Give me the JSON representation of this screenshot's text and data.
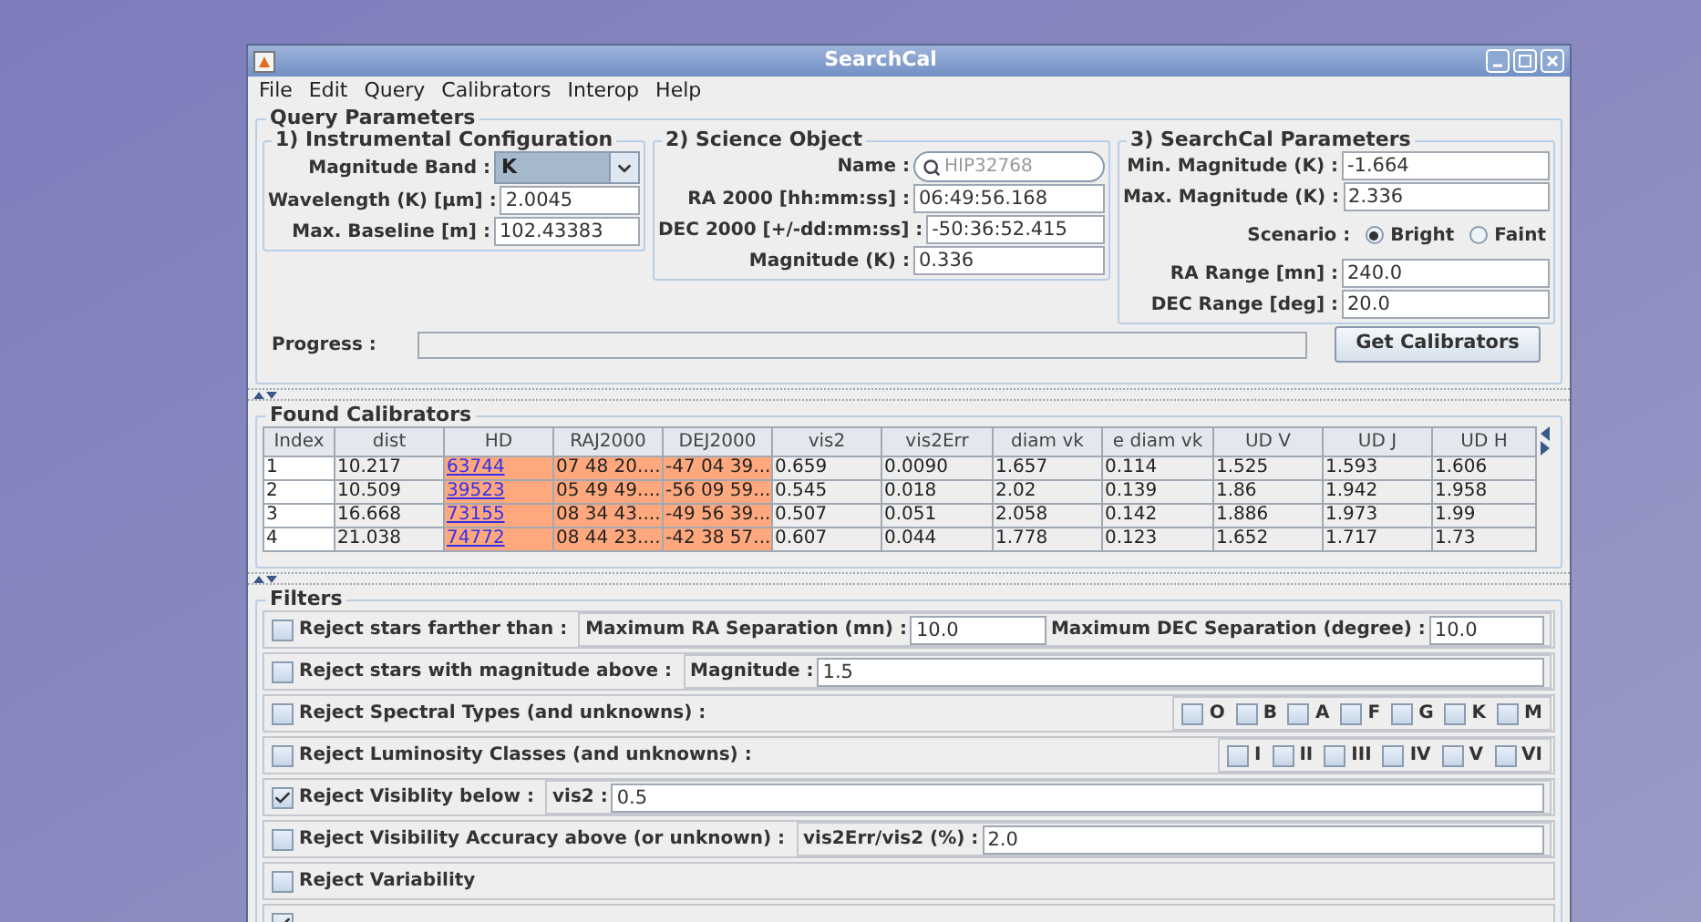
{
  "window": {
    "title": "SearchCal"
  },
  "menu": [
    "File",
    "Edit",
    "Query",
    "Calibrators",
    "Interop",
    "Help"
  ],
  "query_parameters": {
    "title": "Query Parameters",
    "instrumental": {
      "title": "1)  Instrumental Configuration",
      "fields": [
        {
          "kind": "combo",
          "label": "Magnitude Band :",
          "value": "K"
        },
        {
          "kind": "text",
          "label": "Wavelength (K) [µm] :",
          "value": "2.0045"
        },
        {
          "kind": "text",
          "label": "Max. Baseline [m] :",
          "value": "102.43383"
        }
      ]
    },
    "science": {
      "title": "2)  Science Object",
      "fields": [
        {
          "kind": "search",
          "label": "Name :",
          "placeholder": "HIP32768"
        },
        {
          "kind": "text",
          "label": "RA 2000 [hh:mm:ss] :",
          "value": "06:49:56.168"
        },
        {
          "kind": "text",
          "label": "DEC 2000 [+/-dd:mm:ss] :",
          "value": "-50:36:52.415"
        },
        {
          "kind": "text",
          "label": "Magnitude (K) :",
          "value": "0.336"
        }
      ]
    },
    "searchcal": {
      "title": "3)  SearchCal Parameters",
      "fields_top": [
        {
          "label": "Min. Magnitude (K) :",
          "value": "-1.664"
        },
        {
          "label": "Max. Magnitude (K) :",
          "value": "2.336"
        }
      ],
      "scenario": {
        "label": "Scenario :",
        "options": [
          {
            "label": "Bright",
            "selected": true
          },
          {
            "label": "Faint",
            "selected": false
          }
        ]
      },
      "fields_bottom": [
        {
          "label": "RA Range [mn] :",
          "value": "240.0"
        },
        {
          "label": "DEC Range [deg] :",
          "value": "20.0"
        }
      ]
    },
    "progress": {
      "label": "Progress :",
      "level": 0
    },
    "button": "Get Calibrators"
  },
  "found_calibrators": {
    "title": "Found Calibrators",
    "columns": [
      "Index",
      "dist",
      "HD",
      "RAJ2000",
      "DEJ2000",
      "vis2",
      "vis2Err",
      "diam vk",
      "e diam vk",
      "UD V",
      "UD J",
      "UD H"
    ],
    "rows": [
      [
        {
          "text": "1",
          "kind": "index"
        },
        {
          "text": "10.217",
          "kind": "plain"
        },
        {
          "text": "63744",
          "kind": "link"
        },
        {
          "text": "07 48 20....",
          "kind": "highlight"
        },
        {
          "text": "-47 04 39...",
          "kind": "highlight"
        },
        {
          "text": "0.659",
          "kind": "plain"
        },
        {
          "text": "0.0090",
          "kind": "plain"
        },
        {
          "text": "1.657",
          "kind": "plain"
        },
        {
          "text": "0.114",
          "kind": "plain"
        },
        {
          "text": "1.525",
          "kind": "plain"
        },
        {
          "text": "1.593",
          "kind": "plain"
        },
        {
          "text": "1.606",
          "kind": "plain"
        }
      ],
      [
        {
          "text": "2",
          "kind": "index"
        },
        {
          "text": "10.509",
          "kind": "plain"
        },
        {
          "text": "39523",
          "kind": "link"
        },
        {
          "text": "05 49 49....",
          "kind": "highlight"
        },
        {
          "text": "-56 09 59...",
          "kind": "highlight"
        },
        {
          "text": "0.545",
          "kind": "plain"
        },
        {
          "text": "0.018",
          "kind": "plain"
        },
        {
          "text": "2.02",
          "kind": "plain"
        },
        {
          "text": "0.139",
          "kind": "plain"
        },
        {
          "text": "1.86",
          "kind": "plain"
        },
        {
          "text": "1.942",
          "kind": "plain"
        },
        {
          "text": "1.958",
          "kind": "plain"
        }
      ],
      [
        {
          "text": "3",
          "kind": "index"
        },
        {
          "text": "16.668",
          "kind": "plain"
        },
        {
          "text": "73155",
          "kind": "link"
        },
        {
          "text": "08 34 43....",
          "kind": "highlight"
        },
        {
          "text": "-49 56 39...",
          "kind": "highlight"
        },
        {
          "text": "0.507",
          "kind": "plain"
        },
        {
          "text": "0.051",
          "kind": "plain"
        },
        {
          "text": "2.058",
          "kind": "plain"
        },
        {
          "text": "0.142",
          "kind": "plain"
        },
        {
          "text": "1.886",
          "kind": "plain"
        },
        {
          "text": "1.973",
          "kind": "plain"
        },
        {
          "text": "1.99",
          "kind": "plain"
        }
      ],
      [
        {
          "text": "4",
          "kind": "index"
        },
        {
          "text": "21.038",
          "kind": "plain"
        },
        {
          "text": "74772",
          "kind": "link"
        },
        {
          "text": "08 44 23....",
          "kind": "highlight"
        },
        {
          "text": "-42 38 57...",
          "kind": "highlight"
        },
        {
          "text": "0.607",
          "kind": "plain"
        },
        {
          "text": "0.044",
          "kind": "plain"
        },
        {
          "text": "1.778",
          "kind": "plain"
        },
        {
          "text": "0.123",
          "kind": "plain"
        },
        {
          "text": "1.652",
          "kind": "plain"
        },
        {
          "text": "1.717",
          "kind": "plain"
        },
        {
          "text": "1.73",
          "kind": "plain"
        }
      ]
    ]
  },
  "filters": {
    "title": "Filters",
    "rows": [
      {
        "kind": "fields",
        "label": "Reject stars farther than :",
        "checked": false,
        "fields": [
          {
            "label": "Maximum RA Separation (mn) :",
            "value": "10.0"
          },
          {
            "label": "Maximum DEC Separation (degree) :",
            "value": "10.0"
          }
        ]
      },
      {
        "kind": "fields",
        "label": "Reject stars with magnitude above :",
        "checked": false,
        "fields": [
          {
            "label": "Magnitude :",
            "value": "1.5"
          }
        ]
      },
      {
        "kind": "options",
        "label": "Reject Spectral Types (and unknowns) :",
        "checked": false,
        "options": [
          {
            "label": "O",
            "checked": false
          },
          {
            "label": "B",
            "checked": false
          },
          {
            "label": "A",
            "checked": false
          },
          {
            "label": "F",
            "checked": false
          },
          {
            "label": "G",
            "checked": false
          },
          {
            "label": "K",
            "checked": false
          },
          {
            "label": "M",
            "checked": false
          }
        ]
      },
      {
        "kind": "options",
        "label": "Reject Luminosity Classes (and unknowns) :",
        "checked": false,
        "options": [
          {
            "label": "I",
            "checked": false
          },
          {
            "label": "II",
            "checked": false
          },
          {
            "label": "III",
            "checked": false
          },
          {
            "label": "IV",
            "checked": false
          },
          {
            "label": "V",
            "checked": false
          },
          {
            "label": "VI",
            "checked": false
          }
        ]
      },
      {
        "kind": "fields",
        "label": "Reject Visiblity below :",
        "checked": true,
        "fields": [
          {
            "label": "vis2 :",
            "value": "0.5"
          }
        ]
      },
      {
        "kind": "fields",
        "label": "Reject Visibility Accuracy above (or unknown) :",
        "checked": false,
        "fields": [
          {
            "label": "vis2Err/vis2 (%) :",
            "value": "2.0"
          }
        ]
      },
      {
        "kind": "plain",
        "label": "Reject Variability",
        "checked": false
      },
      {
        "kind": "plain",
        "checked": true
      }
    ]
  }
}
